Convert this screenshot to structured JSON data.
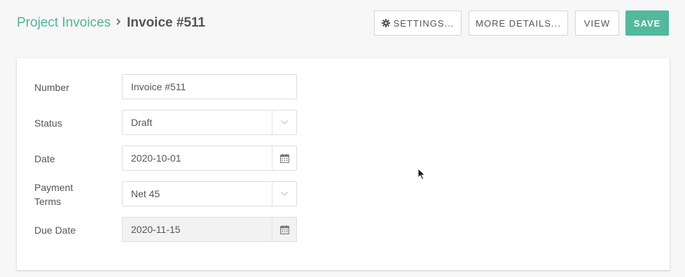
{
  "breadcrumb": {
    "parent": "Project Invoices",
    "current": "Invoice #511",
    "separator_icon": "chevron-right-icon"
  },
  "toolbar": {
    "settings_label": "SETTINGS...",
    "more_details_label": "MORE DETAILS...",
    "view_label": "VIEW",
    "save_label": "SAVE"
  },
  "form": {
    "number": {
      "label": "Number",
      "value": "Invoice #511"
    },
    "status": {
      "label": "Status",
      "value": "Draft"
    },
    "date": {
      "label": "Date",
      "value": "2020-10-01"
    },
    "payment_terms": {
      "label_line1": "Payment",
      "label_line2": "Terms",
      "value": "Net 45"
    },
    "due_date": {
      "label": "Due Date",
      "value": "2020-11-15"
    }
  },
  "colors": {
    "accent": "#52b99c",
    "link": "#4fb59a",
    "page_background": "#f7f7f7",
    "disabled_field": "#f2f2f2"
  }
}
